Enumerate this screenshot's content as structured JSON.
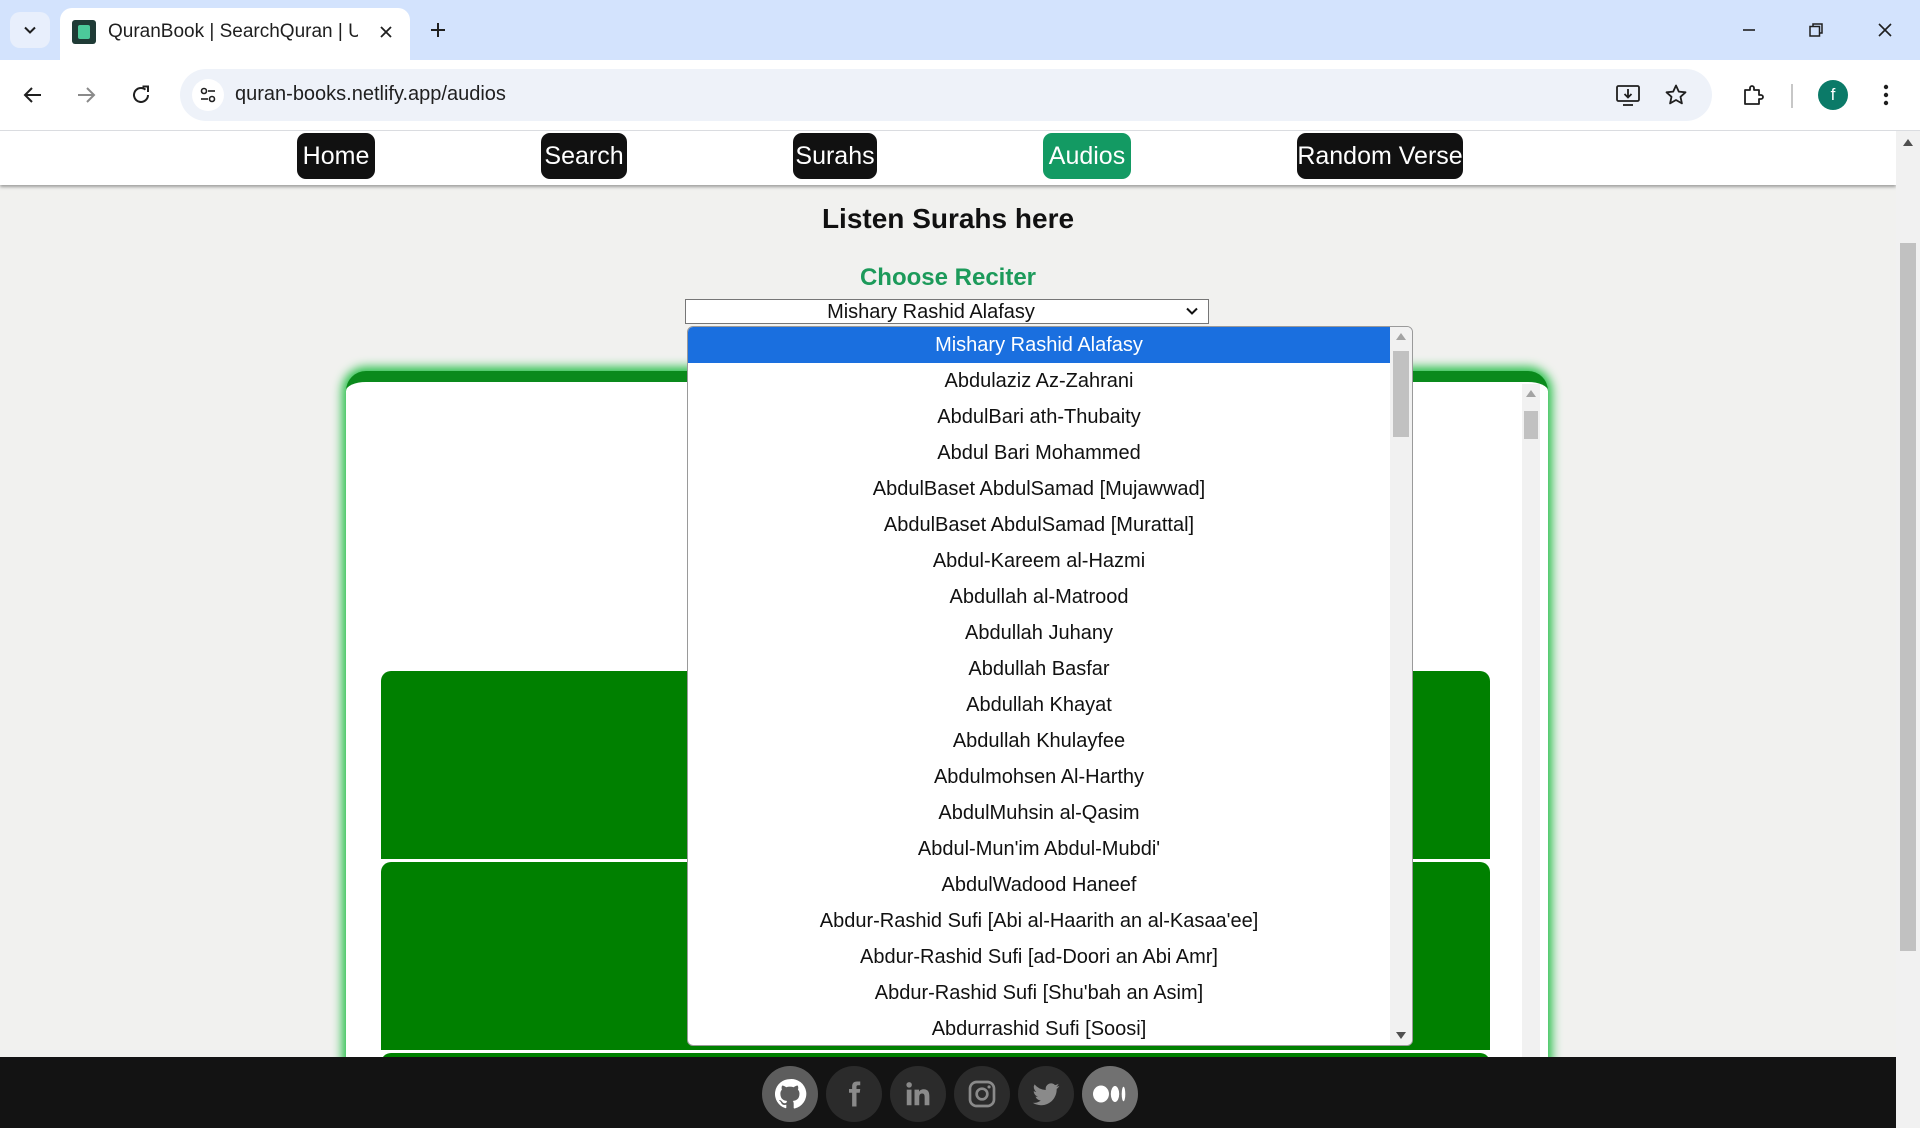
{
  "browser": {
    "tab_title": "QuranBook | SearchQuran | Unc",
    "url": "quran-books.netlify.app/audios",
    "profile_initial": "f"
  },
  "site_nav": {
    "items": [
      {
        "label": "Home",
        "active": false
      },
      {
        "label": "Search",
        "active": false
      },
      {
        "label": "Surahs",
        "active": false
      },
      {
        "label": "Audios",
        "active": true
      },
      {
        "label": "Random Verse",
        "active": false
      }
    ]
  },
  "main": {
    "heading": "Listen Surahs here",
    "reciter_label": "Choose Reciter",
    "selected_reciter": "Mishary Rashid Alafasy"
  },
  "dropdown": {
    "options": [
      "Mishary Rashid Alafasy",
      "Abdulaziz Az-Zahrani",
      "AbdulBari ath-Thubaity",
      "Abdul Bari Mohammed",
      "AbdulBaset AbdulSamad [Mujawwad]",
      "AbdulBaset AbdulSamad [Murattal]",
      "Abdul-Kareem al-Hazmi",
      "Abdullah al-Matrood",
      "Abdullah Juhany",
      "Abdullah Basfar",
      "Abdullah Khayat",
      "Abdullah Khulayfee",
      "Abdulmohsen Al-Harthy",
      "AbdulMuhsin al-Qasim",
      "Abdul-Mun'im Abdul-Mubdi'",
      "AbdulWadood Haneef",
      "Abdur-Rashid Sufi [Abi al-Haarith an al-Kasaa'ee]",
      "Abdur-Rashid Sufi [ad-Doori an Abi Amr]",
      "Abdur-Rashid Sufi [Shu'bah an Asim]",
      "Abdurrashid Sufi [Soosi]"
    ]
  },
  "footer": {
    "social_icons": [
      "github-icon",
      "facebook-icon",
      "linkedin-icon",
      "instagram-icon",
      "twitter-icon",
      "medium-icon"
    ]
  },
  "colors": {
    "accent_green": "#139a63",
    "card_green": "#008000",
    "selected_blue": "#1a6fdf"
  }
}
